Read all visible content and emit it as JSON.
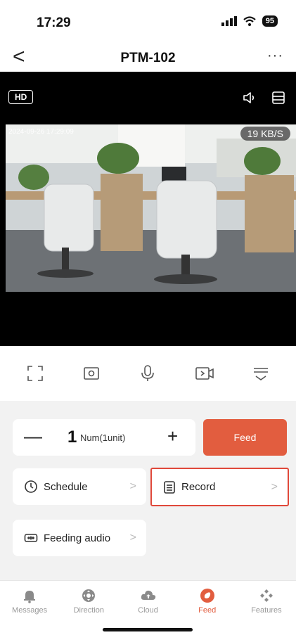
{
  "status": {
    "time": "17:29",
    "battery": "95"
  },
  "nav": {
    "back": "<",
    "title": "PTM-102",
    "more": "···"
  },
  "video": {
    "quality_badge": "HD",
    "timestamp": "2024-09-26 17:29:09",
    "speed": "19 KB/S"
  },
  "controls": [
    "fullscreen-icon",
    "snapshot-icon",
    "microphone-icon",
    "video-record-icon",
    "more-menu-icon"
  ],
  "feed": {
    "minus": "—",
    "quantity": "1",
    "unit": "Num(1unit)",
    "plus": "+",
    "button_label": "Feed"
  },
  "options": {
    "schedule": "Schedule",
    "record": "Record",
    "feeding_audio": "Feeding audio",
    "chevron": ">"
  },
  "tabs": [
    {
      "label": "Messages",
      "icon": "bell-icon"
    },
    {
      "label": "Direction",
      "icon": "joystick-icon"
    },
    {
      "label": "Cloud",
      "icon": "cloud-icon"
    },
    {
      "label": "Feed",
      "icon": "feed-icon",
      "active": true
    },
    {
      "label": "Features",
      "icon": "features-icon"
    }
  ],
  "colors": {
    "accent": "#e25d3f",
    "highlight_border": "#e0483a"
  }
}
